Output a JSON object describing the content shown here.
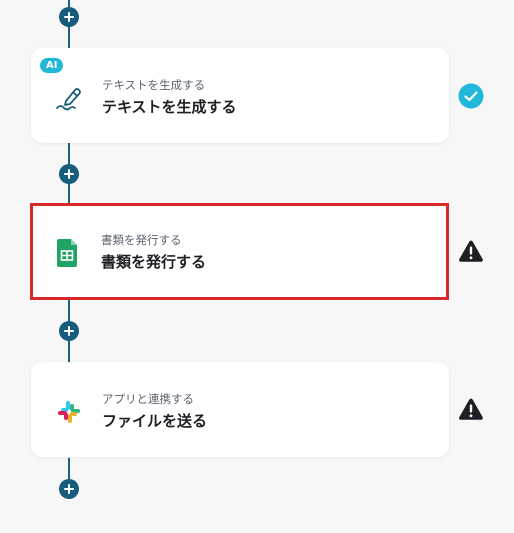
{
  "flow": {
    "steps": [
      {
        "badge": "AI",
        "subtitle": "テキストを生成する",
        "title": "テキストを生成する",
        "icon": "pen-icon",
        "status": "complete"
      },
      {
        "subtitle": "書類を発行する",
        "title": "書類を発行する",
        "icon": "google-sheets-icon",
        "status": "warning",
        "selected": true
      },
      {
        "subtitle": "アプリと連携する",
        "title": "ファイルを送る",
        "icon": "slack-icon",
        "status": "warning"
      }
    ],
    "add_step_icon": "plus-icon"
  },
  "colors": {
    "connector": "#155d7a",
    "ai_badge": "#1fb8d8",
    "complete": "#1fb8d8",
    "warning": "#1d1f24",
    "selected_border": "#d8282a"
  }
}
